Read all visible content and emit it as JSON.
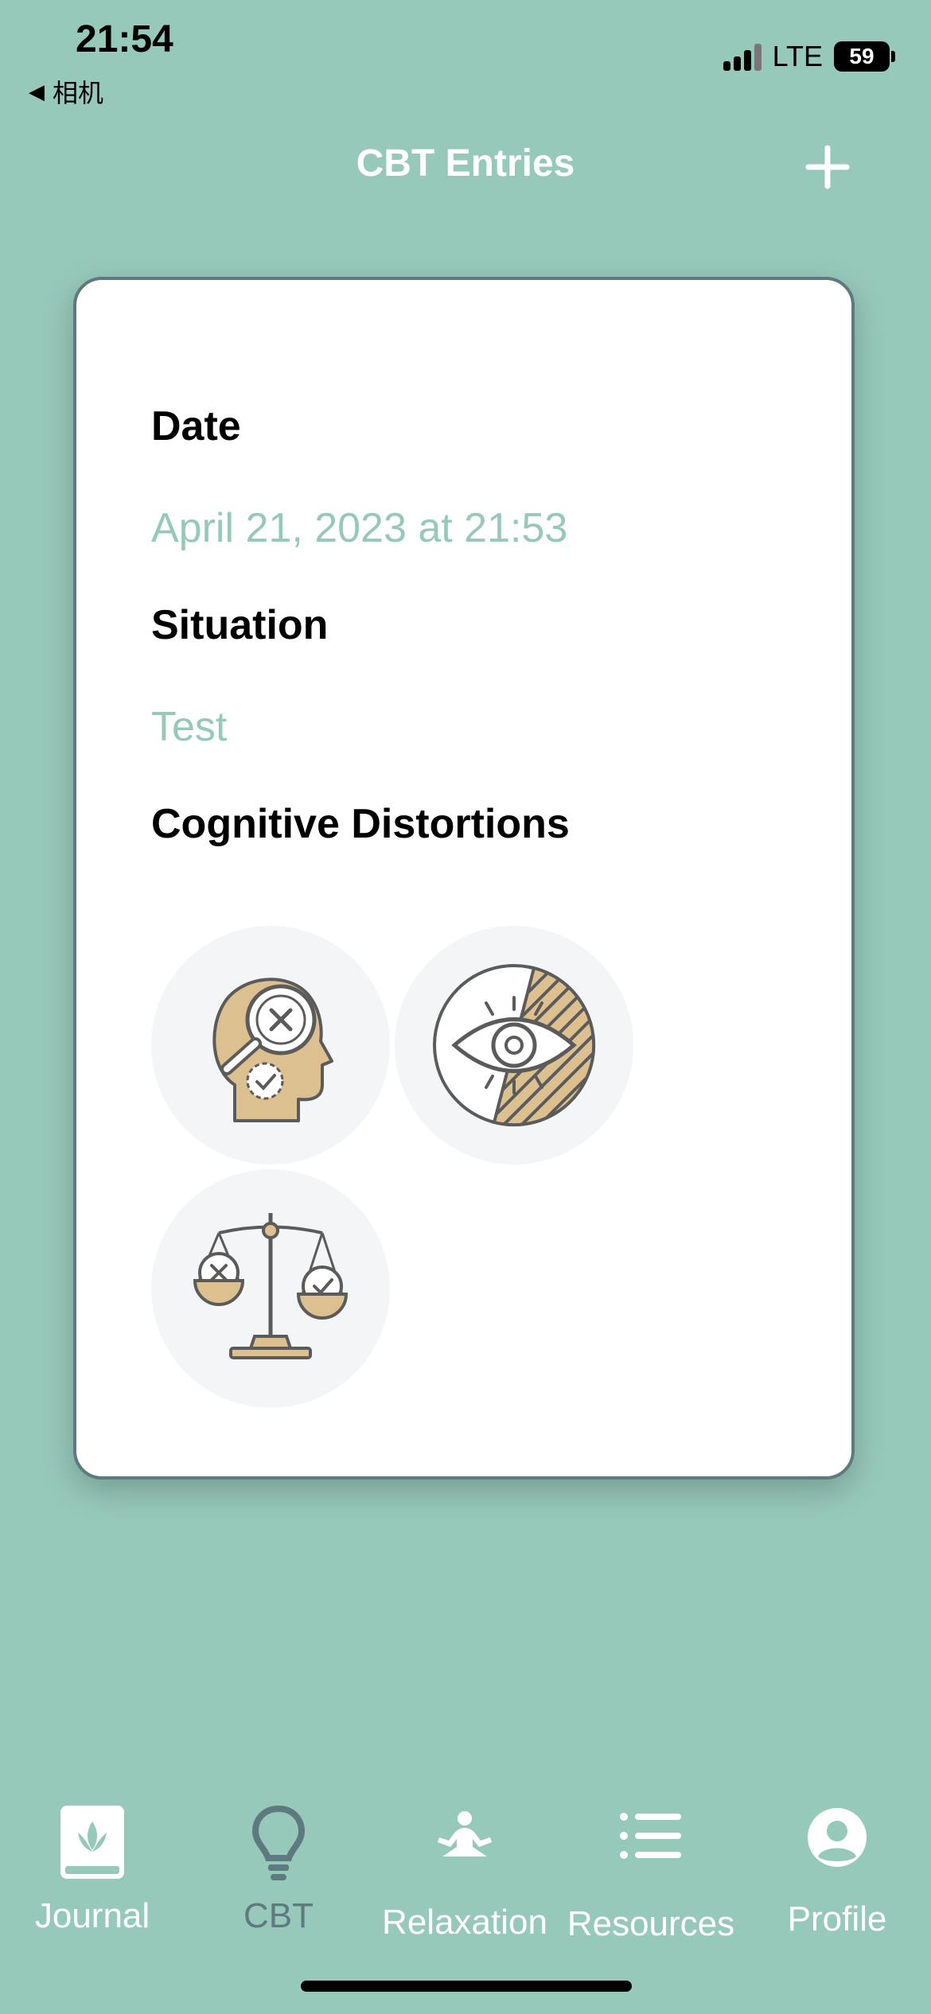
{
  "status_bar": {
    "time": "21:54",
    "back_app": "相机",
    "network": "LTE",
    "battery": "59"
  },
  "header": {
    "title": "CBT Entries",
    "add_icon": "plus-icon"
  },
  "entry": {
    "date_label": "Date",
    "date_value": "April 21, 2023 at 21:53",
    "situation_label": "Situation",
    "situation_value": "Test",
    "distortions_label": "Cognitive Distortions",
    "distortion_icons": [
      "head-magnifier-icon",
      "eye-filter-icon",
      "scales-icon"
    ]
  },
  "tab_bar": {
    "active": "CBT",
    "items": [
      {
        "label": "Journal",
        "icon": "journal-icon"
      },
      {
        "label": "CBT",
        "icon": "lightbulb-icon"
      },
      {
        "label": "Relaxation",
        "icon": "meditation-icon"
      },
      {
        "label": "Resources",
        "icon": "list-icon"
      },
      {
        "label": "Profile",
        "icon": "profile-icon"
      }
    ]
  },
  "colors": {
    "background": "#97c9ba",
    "accent_text": "#97c9ba",
    "card_border": "#5e7980",
    "icon_fill": "#dcc08f"
  }
}
